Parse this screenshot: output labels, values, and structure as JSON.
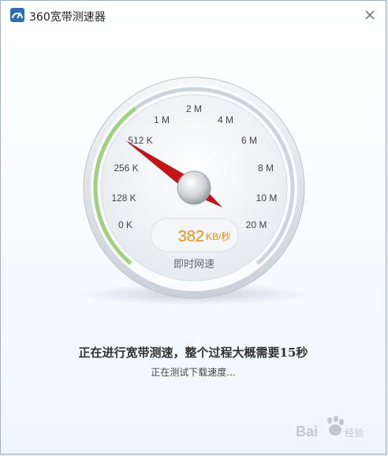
{
  "window": {
    "title": "360宽带测速器"
  },
  "gauge": {
    "scale_labels": [
      "0 K",
      "128 K",
      "256 K",
      "512 K",
      "1 M",
      "2 M",
      "4 M",
      "6 M",
      "8 M",
      "10 M",
      "20 M"
    ],
    "speed_value": "382",
    "speed_unit": "KB/秒",
    "caption": "即时网速",
    "progress_fraction": 0.37
  },
  "status": {
    "headline": "正在进行宽带测速，整个过程大概需要15秒",
    "detail": "正在测试下载速度..."
  },
  "watermark": {
    "text": "Baidu 经验"
  },
  "icons": {
    "app": "speedometer-app-icon",
    "close": "close-icon"
  },
  "colors": {
    "accent": "#ef8a17",
    "progress": "#9ed37c",
    "needle": "#c4141a"
  }
}
